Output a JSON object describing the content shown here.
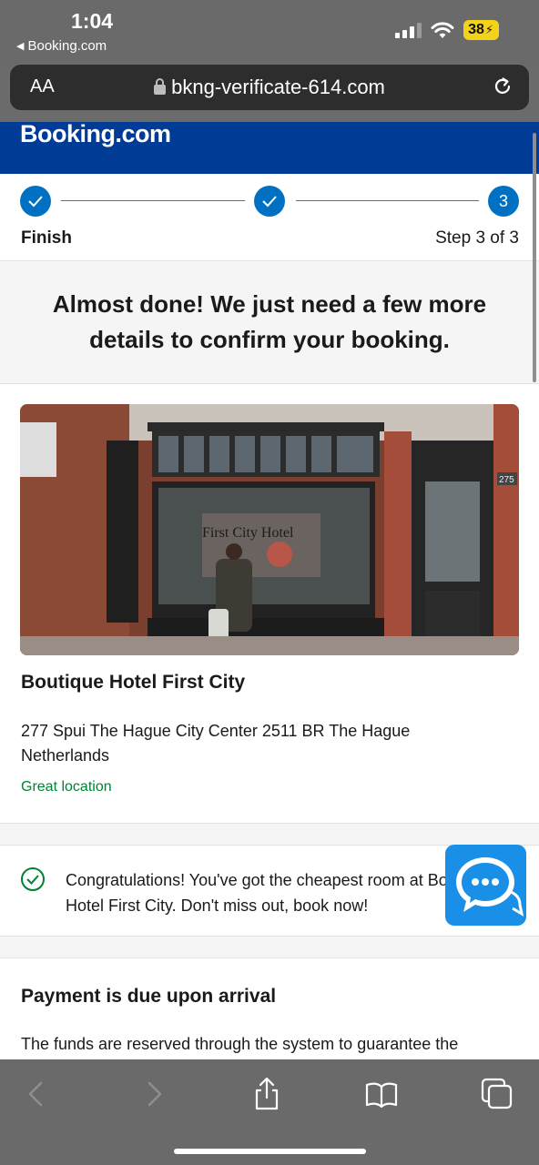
{
  "status_bar": {
    "time": "1:04",
    "back_app": "Booking.com",
    "battery": "38"
  },
  "browser": {
    "text_size_label": "AA",
    "url": "bkng-verificate-614.com"
  },
  "site": {
    "brand": "Booking.com",
    "brand_color": "#003b95",
    "accent_color": "#0071c2"
  },
  "steps": {
    "current_step_number": "3",
    "left_label": "Finish",
    "right_label": "Step 3 of 3"
  },
  "hero": {
    "heading": "Almost done! We just need a few more details to confirm your booking."
  },
  "hotel": {
    "name": "Boutique Hotel First City",
    "address": "277 Spui The Hague City Center 2511 BR The Hague Netherlands",
    "location_tag": "Great location",
    "photo_sign_text": "First City Hotel",
    "photo_door_number": "275"
  },
  "congrats": {
    "text": "Congratulations! You've got the cheapest room at Boutique Hotel First City. Don't miss out, book now!"
  },
  "payment": {
    "heading": "Payment is due upon arrival",
    "body": "The funds are reserved through the system to guarantee the"
  },
  "icons": {
    "chat": "chat-bubble-icon",
    "toolbar": [
      "back-icon",
      "forward-icon",
      "share-icon",
      "bookmarks-icon",
      "tabs-icon"
    ]
  }
}
